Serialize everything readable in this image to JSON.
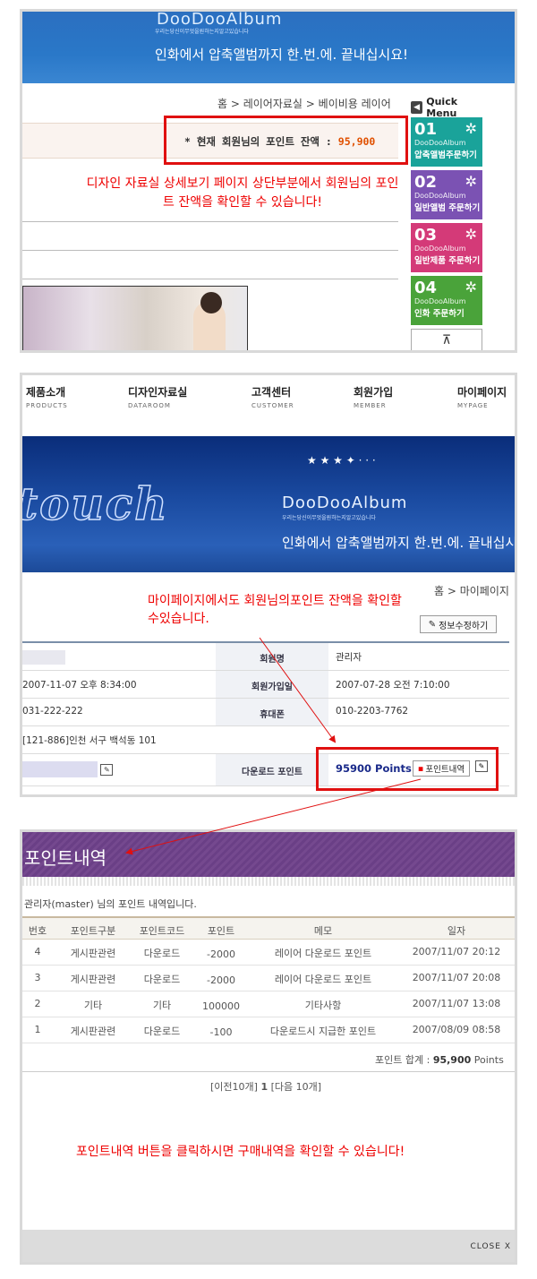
{
  "panel1": {
    "logo": "DooDooAlbum",
    "sublogo": "우리는당신이무엇을원하는지알고있습니다",
    "slogan": "인화에서 압축앨범까지 한.번.에. 끝내십시요!",
    "breadcrumb": "홈 > 레이어자료실 > 베이비용 레이어",
    "point_label": "* 현재 회원님의 포인트 잔액 :",
    "point_value": "95,900",
    "note": "디자인 자료실 상세보기 페이지 상단부분에서 회원님의 포인트 잔액을 확인할 수 있습니다!",
    "quick_menu": {
      "title": "Quick Menu",
      "items": [
        {
          "num": "01",
          "brand": "DooDooAlbum",
          "label": "압축앨범주문하기",
          "color": "#1aa39a"
        },
        {
          "num": "02",
          "brand": "DooDooAlbum",
          "label": "일반앨범 주문하기",
          "color": "#7b52b3"
        },
        {
          "num": "03",
          "brand": "DooDooAlbum",
          "label": "일반제품 주문하기",
          "color": "#d43a78"
        },
        {
          "num": "04",
          "brand": "DooDooAlbum",
          "label": "인화 주문하기",
          "color": "#4aa33a"
        }
      ]
    }
  },
  "panel2": {
    "nav": [
      {
        "ko": "제품소개",
        "en": "PRODUCTS"
      },
      {
        "ko": "디자인자료실",
        "en": "DATAROOM"
      },
      {
        "ko": "고객센터",
        "en": "CUSTOMER"
      },
      {
        "ko": "회원가입",
        "en": "MEMBER"
      },
      {
        "ko": "마이페이지",
        "en": "MYPAGE"
      }
    ],
    "banner_word": "touch",
    "logo": "DooDooAlbum",
    "sublogo": "우리는당신이무엇을원하는지알고있습니다",
    "slogan": "인화에서 압축앨범까지 한.번.에. 끝내십시요.",
    "breadcrumb": "홈 > 마이페이지",
    "note": "마이페이지에서도 회원님의포인트 잔액을 확인할수있습니다.",
    "edit_button": "정보수정하기",
    "rows": [
      {
        "left": "",
        "label": "회원명",
        "right": "관리자"
      },
      {
        "left": "2007-11-07 오후 8:34:00",
        "label": "회원가입일",
        "right": "2007-07-28 오전 7:10:00"
      },
      {
        "left": "031-222-222",
        "label": "휴대폰",
        "right": "010-2203-7762"
      },
      {
        "left": "[121-886]인천 서구 백석동  101",
        "label": "",
        "right": ""
      }
    ],
    "download_label": "다운로드 포인트",
    "points": "95900 Points",
    "points_button": "포인트내역"
  },
  "panel3": {
    "title": "포인트내역",
    "intro": "관리자(master) 님의 포인트 내역입니다.",
    "headers": [
      "번호",
      "포인트구분",
      "포인트코드",
      "포인트",
      "메모",
      "일자"
    ],
    "rows": [
      [
        "4",
        "게시판관련",
        "다운로드",
        "-2000",
        "레이어 다운로드 포인트",
        "2007/11/07 20:12"
      ],
      [
        "3",
        "게시판관련",
        "다운로드",
        "-2000",
        "레이어 다운로드 포인트",
        "2007/11/07 20:08"
      ],
      [
        "2",
        "기타",
        "기타",
        "100000",
        "기타사항",
        "2007/11/07 13:08"
      ],
      [
        "1",
        "게시판관련",
        "다운로드",
        "-100",
        "다운로드시 지급한 포인트",
        "2007/08/09 08:58"
      ]
    ],
    "sum_label": "포인트 합계 :",
    "sum_value": "95,900",
    "sum_unit": "Points",
    "pager_prev": "[이전10개]",
    "pager_current": "1",
    "pager_next": "[다음 10개]",
    "note": "포인트내역 버튼을 클릭하시면 구매내역을 확인할 수 있습니다!",
    "close": "CLOSE X"
  }
}
